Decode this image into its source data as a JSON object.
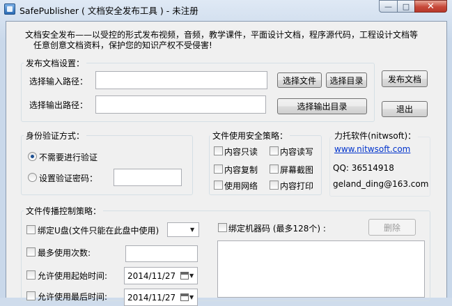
{
  "window": {
    "title": "SafePublisher ( 文档安全发布工具 ) - 未注册",
    "min_glyph": "—",
    "max_glyph": "□",
    "close_glyph": "✕"
  },
  "intro": {
    "line1": "文档安全发布——以受控的形式发布视频，音频，教学课件，平面设计文档，程序源代码，工程设计文档等",
    "line2": "任意创意文档资料，保护您的知识产权不受侵害!"
  },
  "publish": {
    "group_label": "发布文档设置：",
    "input_label": "选择输入路径：",
    "input_value": "",
    "output_label": "选择输出路径：",
    "output_value": "",
    "select_file": "选择文件",
    "select_dir": "选择目录",
    "select_output_dir": "选择输出目录"
  },
  "actions": {
    "publish": "发布文档",
    "exit": "退出"
  },
  "auth": {
    "group_label": "身份验证方式：",
    "no_auth": "不需要进行验证",
    "set_password": "设置验证密码：",
    "password_value": ""
  },
  "security": {
    "group_label": "文件使用安全策略：",
    "options": [
      "内容只读",
      "内容读写",
      "内容复制",
      "屏幕截图",
      "使用网络",
      "内容打印"
    ]
  },
  "company": {
    "name": "力托软件(nitwsoft)：",
    "website": "www.nitwsoft.com",
    "qq": "QQ:  36514918",
    "email": "geland_ding@163.com"
  },
  "spread": {
    "group_label": "文件传播控制策略：",
    "bind_udisk": "绑定U盘(文件只能在此盘中使用)",
    "max_uses": "最多使用次数:",
    "max_uses_value": "",
    "start_time": "允许使用起始时间:",
    "start_date": "2014/11/27",
    "end_time": "允许使用最后时间:",
    "end_date": "2014/11/27",
    "bind_machine": "绑定机器码 (最多128个) :",
    "delete": "删除"
  },
  "icons": {
    "dropdown": "chevron-down-icon",
    "calendar": "calendar-icon"
  }
}
